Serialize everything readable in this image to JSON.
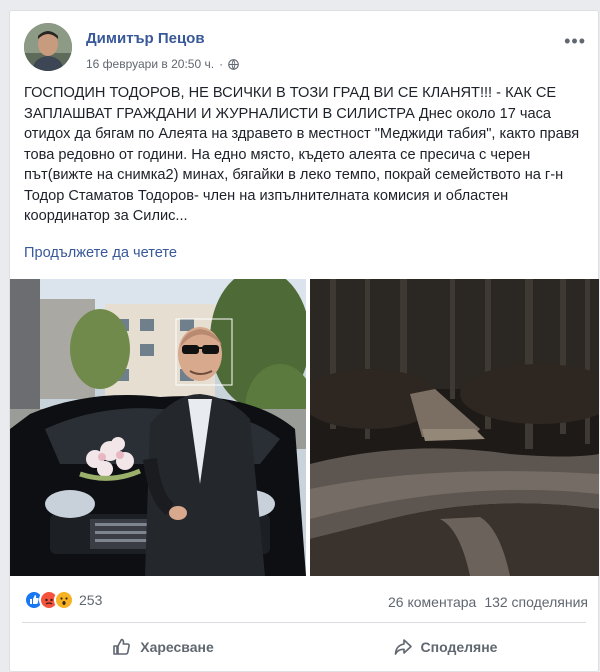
{
  "post": {
    "author": "Димитър Пецов",
    "date": "16 февруари в 20:50 ч.",
    "text": "ГОСПОДИН ТОДОРОВ, НЕ ВСИЧКИ В ТОЗИ ГРАД ВИ СЕ КЛАНЯТ!!! - КАК СЕ ЗАПЛАШВАТ ГРАЖДАНИ И ЖУРНАЛИСТИ В СИЛИСТРА Днес около 17 часа отидох да бягам по Алеята на здравето в местност \"Меджиди табия\", както правя това редовно от години. На едно място, където алеята се пресича с черен път(вижте на снимка2) минах, бягайки в леко темпо, покрай семейството на г-н Тодор Стаматов Тодоров- член на изпълнителната комисия и областен координатор за Силис...",
    "see_more": "Продължете да четете"
  },
  "stats": {
    "reaction_count": "253",
    "comments": "26 коментара",
    "shares": "132 споделяния",
    "reaction_colors": [
      "#1877f2",
      "#f5533d",
      "#f7b125"
    ]
  },
  "actions": {
    "like": "Харесване",
    "share": "Споделяне"
  },
  "icons": {
    "privacy": "globe-icon",
    "more": "more-options-icon",
    "like": "thumbs-up-icon",
    "share": "share-arrow-icon"
  }
}
